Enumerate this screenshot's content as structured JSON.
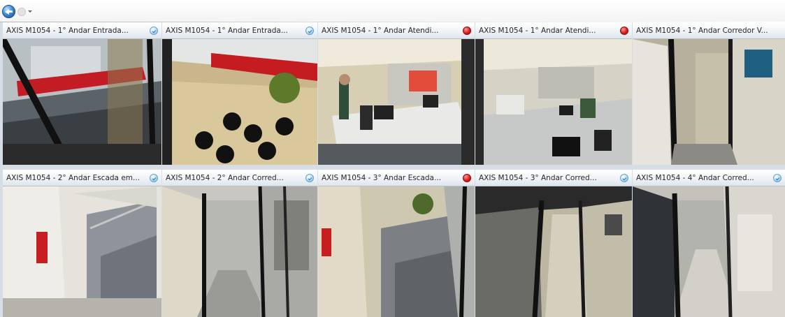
{
  "toolbar": {
    "back_icon": "back-arrow-icon",
    "forward_icon": "forward-arrow-icon",
    "history_icon": "dropdown-icon"
  },
  "cameras": [
    {
      "title": "AXIS M1054 - 1° Andar Entrada...",
      "status": "idle",
      "status_icon": "info-icon",
      "status_color": "#6fb3e2"
    },
    {
      "title": "AXIS M1054 - 1° Andar Entrada...",
      "status": "idle",
      "status_icon": "info-icon",
      "status_color": "#6fb3e2"
    },
    {
      "title": "AXIS M1054 - 1° Andar Atendi...",
      "status": "rec",
      "status_icon": "record-icon",
      "status_color": "#e11c1c"
    },
    {
      "title": "AXIS M1054 - 1° Andar Atendi...",
      "status": "rec",
      "status_icon": "record-icon",
      "status_color": "#e11c1c"
    },
    {
      "title": "AXIS M1054 - 1° Andar Corredor V...",
      "status": "none",
      "status_icon": "",
      "status_color": ""
    },
    {
      "title": "AXIS M1054 - 2° Andar Escada em...",
      "status": "idle",
      "status_icon": "info-icon",
      "status_color": "#6fb3e2"
    },
    {
      "title": "AXIS M1054 - 2° Andar Corred...",
      "status": "idle",
      "status_icon": "info-icon",
      "status_color": "#6fb3e2"
    },
    {
      "title": "AXIS M1054 - 3° Andar Escada...",
      "status": "rec",
      "status_icon": "record-icon",
      "status_color": "#e11c1c"
    },
    {
      "title": "AXIS M1054 - 3° Andar Corred...",
      "status": "idle",
      "status_icon": "info-icon",
      "status_color": "#6fb3e2"
    },
    {
      "title": "AXIS M1054 - 4° Andar Corred...",
      "status": "idle",
      "status_icon": "info-icon",
      "status_color": "#6fb3e2"
    }
  ]
}
